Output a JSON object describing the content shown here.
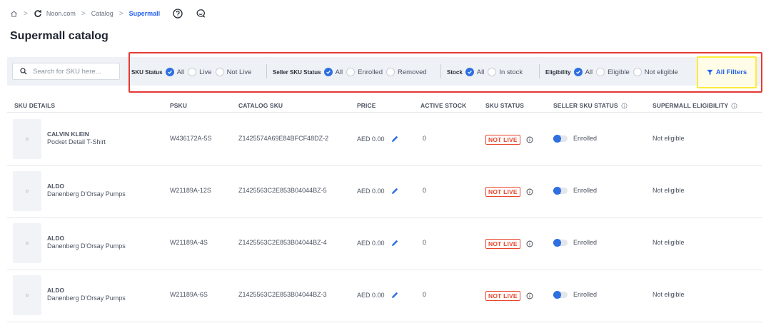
{
  "breadcrumb": {
    "items": [
      "Noon.com",
      "Catalog"
    ],
    "active": "Supermall"
  },
  "page": {
    "title": "Supermall catalog"
  },
  "search": {
    "placeholder": "Search for SKU here..."
  },
  "filters": {
    "sku_status": {
      "label": "SKU Status",
      "options": [
        "All",
        "Live",
        "Not Live"
      ],
      "selected": "All"
    },
    "seller_sku_status": {
      "label": "Seller SKU Status",
      "options": [
        "All",
        "Enrolled",
        "Removed"
      ],
      "selected": "All"
    },
    "stock": {
      "label": "Stock",
      "options": [
        "All",
        "In stock"
      ],
      "selected": "All"
    },
    "eligibility": {
      "label": "Eligibility",
      "options": [
        "All",
        "Eligible",
        "Not eligible"
      ],
      "selected": "All"
    },
    "all_filters_label": "All Filters"
  },
  "table": {
    "columns": [
      "SKU DETAILS",
      "PSKU",
      "CATALOG SKU",
      "PRICE",
      "ACTIVE STOCK",
      "SKU STATUS",
      "SELLER SKU STATUS",
      "SUPERMALL ELIGIBILITY"
    ],
    "rows": [
      {
        "brand": "CALVIN KLEIN",
        "name": "Pocket Detail T-Shirt",
        "psku": "W436172A-5S",
        "catalog_sku": "Z1425574A69E84BFCF48DZ-2",
        "price": "AED 0.00",
        "active_stock": "0",
        "sku_status": "NOT LIVE",
        "seller_status": "Enrolled",
        "eligibility": "Not eligible"
      },
      {
        "brand": "ALDO",
        "name": "Danenberg D'Orsay Pumps",
        "psku": "W21189A-12S",
        "catalog_sku": "Z1425563C2E853B04044BZ-5",
        "price": "AED 0.00",
        "active_stock": "0",
        "sku_status": "NOT LIVE",
        "seller_status": "Enrolled",
        "eligibility": "Not eligible"
      },
      {
        "brand": "ALDO",
        "name": "Danenberg D'Orsay Pumps",
        "psku": "W21189A-4S",
        "catalog_sku": "Z1425563C2E853B04044BZ-4",
        "price": "AED 0.00",
        "active_stock": "0",
        "sku_status": "NOT LIVE",
        "seller_status": "Enrolled",
        "eligibility": "Not eligible"
      },
      {
        "brand": "ALDO",
        "name": "Danenberg D'Orsay Pumps",
        "psku": "W21189A-6S",
        "catalog_sku": "Z1425563C2E853B04044BZ-3",
        "price": "AED 0.00",
        "active_stock": "0",
        "sku_status": "NOT LIVE",
        "seller_status": "Enrolled",
        "eligibility": "Not eligible"
      }
    ]
  },
  "colors": {
    "accent": "#2f6fe0",
    "link": "#2563eb",
    "danger": "#e8452c",
    "highlight_red": "#e53935",
    "highlight_yellow": "#ffeb3b"
  },
  "icons": [
    "home-icon",
    "refresh-icon",
    "help-icon",
    "chat-icon",
    "search-icon",
    "filter-icon",
    "edit-icon",
    "info-icon"
  ]
}
